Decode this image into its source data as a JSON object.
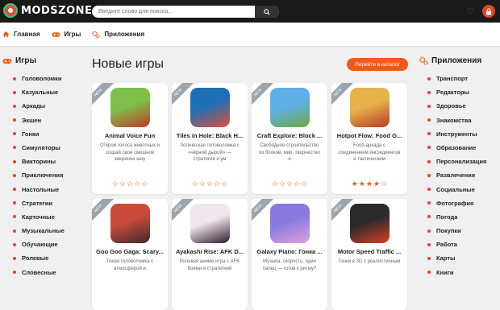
{
  "header": {
    "logo_text": "MODSZONE",
    "search_placeholder": "Введите слово для поиска..."
  },
  "nav": [
    {
      "label": "Главная",
      "icon": "home-icon"
    },
    {
      "label": "Игры",
      "icon": "gamepad-icon"
    },
    {
      "label": "Приложения",
      "icon": "gears-icon"
    }
  ],
  "games_sidebar": {
    "title": "Игры",
    "items": [
      "Головоломки",
      "Казуальные",
      "Аркады",
      "Экшен",
      "Гонки",
      "Симуляторы",
      "Викторины",
      "Приключения",
      "Настольные",
      "Стратегии",
      "Карточные",
      "Музыкальные",
      "Обучающие",
      "Ролевые",
      "Словесные"
    ]
  },
  "apps_sidebar": {
    "title": "Приложения",
    "items": [
      "Транспорт",
      "Редакторы",
      "Здоровье",
      "Знакомства",
      "Инструменты",
      "Образование",
      "Персонализация",
      "Развлечения",
      "Социальные",
      "Фотография",
      "Погода",
      "Покупки",
      "Работа",
      "Карты",
      "Книги"
    ]
  },
  "main": {
    "title": "Новые игры",
    "catalog_button": "Перейти в каталог",
    "badge": "NEW",
    "cards": [
      {
        "title": "Animal Voice Fun",
        "desc": "Открой голоса животных и создай своё смешное звериное шоу",
        "rating": 0,
        "thumb_colors": [
          "#7ec14a",
          "#c0392b"
        ]
      },
      {
        "title": "Tiles in Hole: Black H...",
        "desc": "Логическая головоломка с «чёрной дырой» — стратегия и ум",
        "rating": 0,
        "thumb_colors": [
          "#1f6fb5",
          "#d9533a"
        ]
      },
      {
        "title": "Craft Explore: Block ...",
        "desc": "Свободное строительство из блоков, мир, творчество и",
        "rating": 0,
        "thumb_colors": [
          "#5fb0e8",
          "#6fa83d"
        ]
      },
      {
        "title": "Hotpot Flow: Food G...",
        "desc": "Food-аркада с соединением ингредиентов и тактическим",
        "rating": 4,
        "thumb_colors": [
          "#e7b24a",
          "#b8392a"
        ]
      },
      {
        "title": "Goo Goo Gaga: Scary...",
        "desc": "Тихая головоломка с атмосферой и",
        "rating": 0,
        "thumb_colors": [
          "#c94a3a",
          "#3a2a2a"
        ]
      },
      {
        "title": "Ayakashi Rise: AFK D...",
        "desc": "Ролевая аниме игра с AFK боями и стратегией",
        "rating": 0,
        "thumb_colors": [
          "#f2e6ee",
          "#2a1a2a"
        ]
      },
      {
        "title": "Galaxy Piano: Гонка ...",
        "desc": "Музыка, скорость, один палец — готов к ритму?",
        "rating": 0,
        "thumb_colors": [
          "#8a7ae0",
          "#e0a0d8"
        ]
      },
      {
        "title": "Motor Speed Traffic ...",
        "desc": "Гонки в 3D с реалистичным",
        "rating": 0,
        "thumb_colors": [
          "#2a2a2a",
          "#d8402a"
        ]
      }
    ]
  }
}
